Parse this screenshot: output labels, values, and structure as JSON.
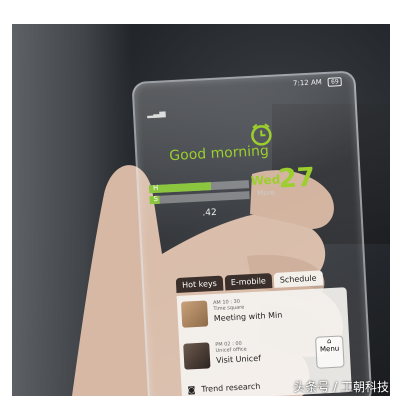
{
  "status_bar": {
    "time": "7:12 AM",
    "battery": "69"
  },
  "greeting": "Good morning",
  "date": {
    "day": "Wed",
    "number": "27",
    "more": "More"
  },
  "stats": [
    {
      "label": "H",
      "fill": 0.62
    },
    {
      "label": "S",
      "fill": 0.1
    }
  ],
  "weather_value": ".42",
  "tabs": [
    "Hot keys",
    "E-mobile",
    "Schedule"
  ],
  "events": [
    {
      "time": "AM 10 : 30",
      "place": "Time square",
      "title": "Meeting with Min"
    },
    {
      "time": "PM 02 : 00",
      "place": "Unicef office",
      "title": "Visit Unicef"
    }
  ],
  "trend": "Trend research",
  "menu_label": "Menu",
  "watermark": "头条号 / 工朝科技",
  "colors": {
    "accent_green": "#9ccf2d",
    "tab_dark": "#3a2f2a"
  }
}
